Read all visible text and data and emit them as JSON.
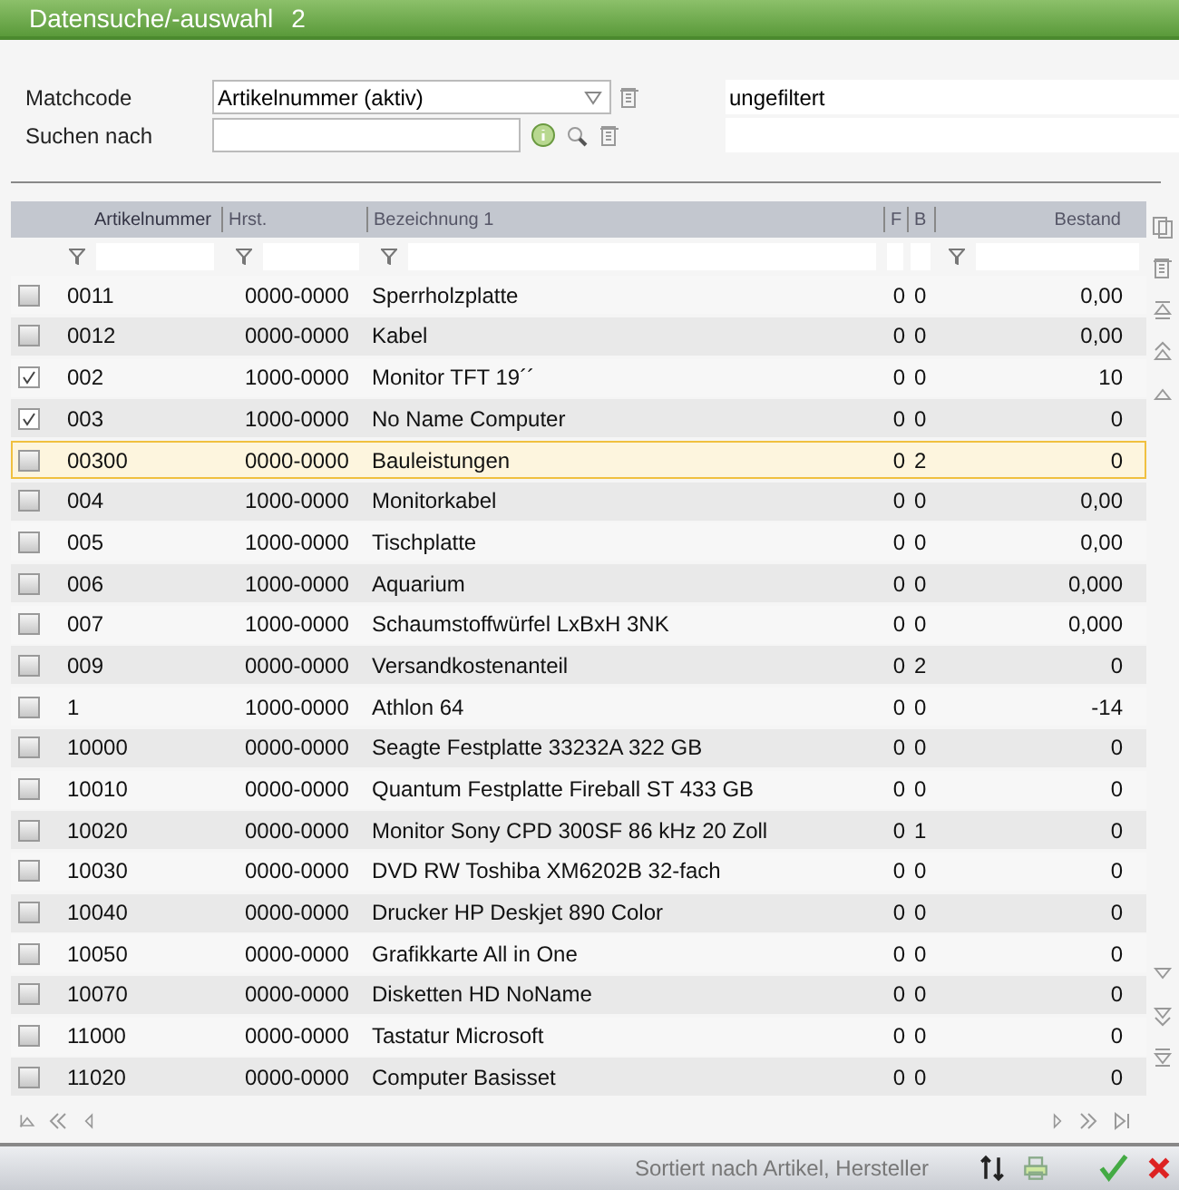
{
  "window": {
    "title": "Datensuche/-auswahl",
    "number": "2"
  },
  "form": {
    "matchcode_label": "Matchcode",
    "matchcode_value": "Artikelnummer (aktiv)",
    "filter_status": "ungefiltert",
    "search_label": "Suchen nach"
  },
  "table": {
    "columns": [
      {
        "label": "Artikelnummer",
        "sorted": true,
        "filter": true
      },
      {
        "label": "Hrst.",
        "sorted": false,
        "filter": true
      },
      {
        "label": "Bezeichnung 1",
        "sorted": false,
        "filter": true
      },
      {
        "label": "F",
        "sorted": false,
        "filter": false
      },
      {
        "label": "B",
        "sorted": false,
        "filter": false
      },
      {
        "label": "Bestand",
        "sorted": false,
        "filter": true
      }
    ],
    "rows": [
      {
        "checked": false,
        "selected": false,
        "cells": [
          "0011",
          "0000-0000",
          "Sperrholzplatte",
          "0",
          "0",
          "0,00"
        ]
      },
      {
        "checked": false,
        "selected": false,
        "cells": [
          "0012",
          "0000-0000",
          "Kabel",
          "0",
          "0",
          "0,00"
        ]
      },
      {
        "checked": true,
        "selected": false,
        "cells": [
          "002",
          "1000-0000",
          "Monitor TFT 19´´",
          "0",
          "0",
          "10"
        ]
      },
      {
        "checked": true,
        "selected": false,
        "cells": [
          "003",
          "1000-0000",
          "No Name Computer",
          "0",
          "0",
          "0"
        ]
      },
      {
        "checked": false,
        "selected": true,
        "cells": [
          "00300",
          "0000-0000",
          "Bauleistungen",
          "0",
          "2",
          "0"
        ]
      },
      {
        "checked": false,
        "selected": false,
        "cells": [
          "004",
          "1000-0000",
          "Monitorkabel",
          "0",
          "0",
          "0,00"
        ]
      },
      {
        "checked": false,
        "selected": false,
        "cells": [
          "005",
          "1000-0000",
          "Tischplatte",
          "0",
          "0",
          "0,00"
        ]
      },
      {
        "checked": false,
        "selected": false,
        "cells": [
          "006",
          "1000-0000",
          "Aquarium",
          "0",
          "0",
          "0,000"
        ]
      },
      {
        "checked": false,
        "selected": false,
        "cells": [
          "007",
          "1000-0000",
          "Schaumstoffwürfel LxBxH 3NK",
          "0",
          "0",
          "0,000"
        ]
      },
      {
        "checked": false,
        "selected": false,
        "cells": [
          "009",
          "0000-0000",
          "Versandkostenanteil",
          "0",
          "2",
          "0"
        ]
      },
      {
        "checked": false,
        "selected": false,
        "cells": [
          "1",
          "1000-0000",
          "Athlon 64",
          "0",
          "0",
          "-14"
        ]
      },
      {
        "checked": false,
        "selected": false,
        "cells": [
          "10000",
          "0000-0000",
          "Seagte Festplatte 33232A 322 GB",
          "0",
          "0",
          "0"
        ]
      },
      {
        "checked": false,
        "selected": false,
        "cells": [
          "10010",
          "0000-0000",
          "Quantum Festplatte Fireball ST 433 GB",
          "0",
          "0",
          "0"
        ]
      },
      {
        "checked": false,
        "selected": false,
        "cells": [
          "10020",
          "0000-0000",
          "Monitor Sony CPD 300SF 86 kHz 20 Zoll",
          "0",
          "1",
          "0"
        ]
      },
      {
        "checked": false,
        "selected": false,
        "cells": [
          "10030",
          "0000-0000",
          "DVD RW Toshiba XM6202B 32-fach",
          "0",
          "0",
          "0"
        ]
      },
      {
        "checked": false,
        "selected": false,
        "cells": [
          "10040",
          "0000-0000",
          "Drucker HP Deskjet 890 Color",
          "0",
          "0",
          "0"
        ]
      },
      {
        "checked": false,
        "selected": false,
        "cells": [
          "10050",
          "0000-0000",
          "Grafikkarte All in One",
          "0",
          "0",
          "0"
        ]
      },
      {
        "checked": false,
        "selected": false,
        "cells": [
          "10070",
          "0000-0000",
          "Disketten HD NoName",
          "0",
          "0",
          "0"
        ]
      },
      {
        "checked": false,
        "selected": false,
        "cells": [
          "11000",
          "0000-0000",
          "Tastatur Microsoft",
          "0",
          "0",
          "0"
        ]
      },
      {
        "checked": false,
        "selected": false,
        "cells": [
          "11020",
          "0000-0000",
          "Computer Basisset",
          "0",
          "0",
          "0"
        ]
      }
    ]
  },
  "status_bar": {
    "text": "Sortiert nach Artikel, Hersteller"
  }
}
